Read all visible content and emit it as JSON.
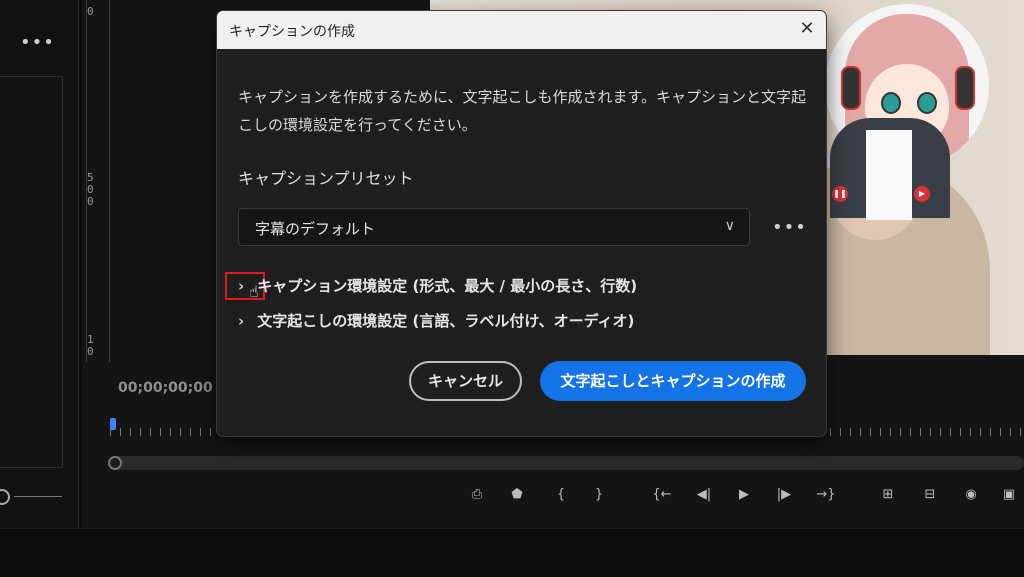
{
  "dialog": {
    "title": "キャプションの作成",
    "description": "キャプションを作成するために、文字起こしも作成されます。キャプションと文字起こしの環境設定を行ってください。",
    "preset_label": "キャプションプリセット",
    "preset_value": "字幕のデフォルト",
    "more_label": "•••",
    "close_label": "✕",
    "expand_caption_settings": "キャプション環境設定 (形式、最大 / 最小の長さ、行数)",
    "expand_transcript_settings": "文字起こしの環境設定 (言語、ラベル付け、オーディオ)",
    "cancel_label": "キャンセル",
    "create_label": "文字起こしとキャプションの作成"
  },
  "left_panel": {
    "more_label": "•••"
  },
  "monitor": {
    "timecode": "00;00;00;00",
    "ruler_labels": [
      "0",
      "5",
      "0",
      "0",
      "1",
      "0"
    ]
  },
  "transport": {
    "icons": [
      "export-frame-icon",
      "marker-icon",
      "mark-in-icon",
      "mark-out-icon",
      "go-to-in-icon",
      "step-back-icon",
      "play-icon",
      "step-forward-icon",
      "go-to-out-icon",
      "lift-icon",
      "extract-icon",
      "camera-icon"
    ]
  },
  "colors": {
    "accent": "#1473e6",
    "highlight": "#e01b24",
    "playhead": "#3b82f6"
  }
}
